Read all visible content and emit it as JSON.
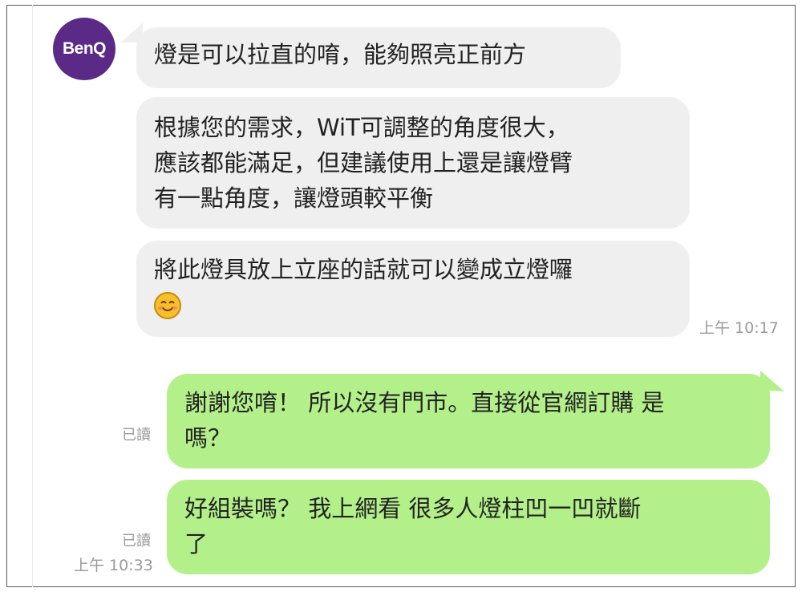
{
  "contact": {
    "avatar_text": "BenQ"
  },
  "colors": {
    "incoming_bubble": "#efefef",
    "outgoing_bubble": "#b4f08a",
    "avatar_bg": "#5b2a86",
    "meta_text": "#9a9a9a"
  },
  "messages": [
    {
      "direction": "incoming",
      "lines": [
        "燈是可以拉直的唷，能夠照亮正前方"
      ]
    },
    {
      "direction": "incoming",
      "lines": [
        "根據您的需求，WiT可調整的角度很大，",
        "應該都能滿足，但建議使用上還是讓燈臂",
        "有一點角度，讓燈頭較平衡"
      ]
    },
    {
      "direction": "incoming",
      "lines": [
        "將此燈具放上立座的話就可以變成立燈囉"
      ],
      "emoji": "smiling-face-emoji",
      "time": "上午 10:17"
    },
    {
      "direction": "outgoing",
      "lines": [
        "謝謝您唷！ 所以沒有門市。直接從官網訂購 是",
        "嗎？"
      ],
      "read": "已讀"
    },
    {
      "direction": "outgoing",
      "lines": [
        "好組裝嗎？ 我上網看 很多人燈柱凹一凹就斷",
        "了"
      ],
      "read": "已讀",
      "time": "上午 10:33"
    }
  ]
}
